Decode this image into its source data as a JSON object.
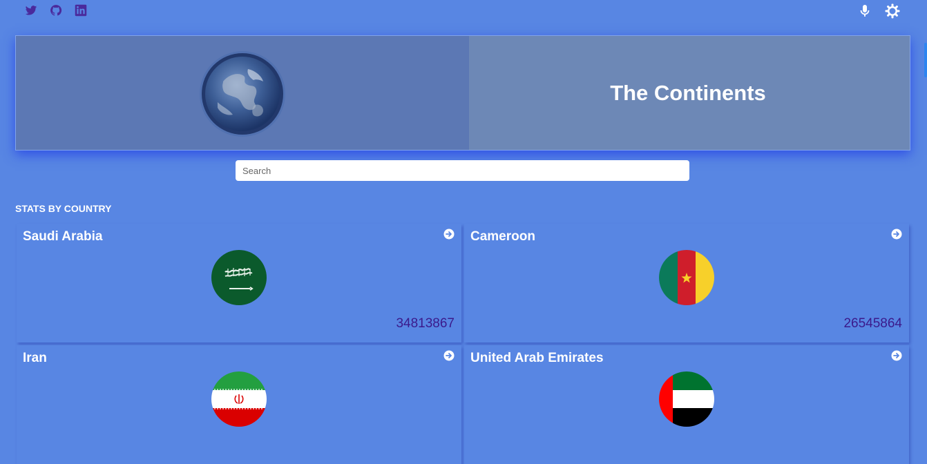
{
  "header": {
    "social_icons": [
      "twitter-icon",
      "github-icon",
      "linkedin-icon"
    ],
    "right_icons": [
      "microphone-icon",
      "settings-gear-icon"
    ]
  },
  "hero": {
    "title": "The Continents",
    "image": "earth-globe-icon"
  },
  "search": {
    "placeholder": "Search",
    "value": ""
  },
  "section_title": "STATS BY COUNTRY",
  "countries": [
    {
      "name": "Saudi Arabia",
      "population": "34813867",
      "flag": "saudi-arabia-flag"
    },
    {
      "name": "Cameroon",
      "population": "26545864",
      "flag": "cameroon-flag"
    },
    {
      "name": "Iran",
      "population": "",
      "flag": "iran-flag"
    },
    {
      "name": "United Arab Emirates",
      "population": "",
      "flag": "uae-flag"
    }
  ],
  "colors": {
    "background": "#5886e3",
    "hero_left": "#5c78b4",
    "hero_right": "#6d88b6",
    "social_icon": "#4a2a9c",
    "population_text": "#3b1a8c"
  }
}
